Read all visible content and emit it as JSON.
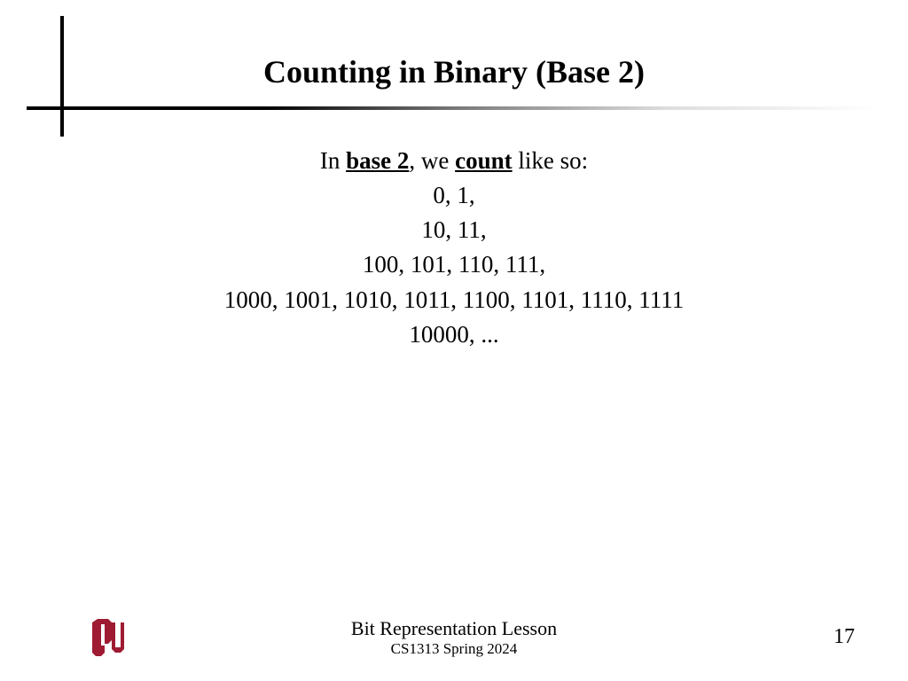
{
  "slide": {
    "title": "Counting in Binary (Base 2)",
    "intro": {
      "pre": "In ",
      "base2": "base 2",
      "mid": ", we ",
      "count": "count",
      "post": " like so:"
    },
    "lines": {
      "l1": "0, 1,",
      "l2": "10, 11,",
      "l3": "100, 101, 110, 111,",
      "l4": "1000, 1001, 1010, 1011, 1100, 1101, 1110, 1111",
      "l5": "10000, ..."
    }
  },
  "footer": {
    "lesson": "Bit Representation Lesson",
    "course": "CS1313 Spring 2024",
    "page": "17"
  },
  "colors": {
    "logo": "#9e1b32"
  }
}
